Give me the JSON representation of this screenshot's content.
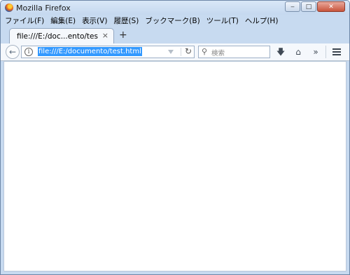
{
  "window": {
    "title": "Mozilla Firefox",
    "icon": "firefox-icon"
  },
  "window_controls": {
    "minimize": "‒",
    "maximize": "□",
    "close": "✕"
  },
  "menu": [
    "ファイル(F)",
    "編集(E)",
    "表示(V)",
    "履歴(S)",
    "ブックマーク(B)",
    "ツール(T)",
    "ヘルプ(H)"
  ],
  "tab": {
    "label": "file:///E:/doc...ento/test.html",
    "close": "×",
    "new": "+"
  },
  "nav": {
    "back": "←",
    "info": "i",
    "url": "file:///E:/documento/test.html",
    "reload": "↻",
    "search_icon": "⚲",
    "search_placeholder": "検索",
    "download": "🡇",
    "home": "⌂",
    "overflow": "»"
  }
}
